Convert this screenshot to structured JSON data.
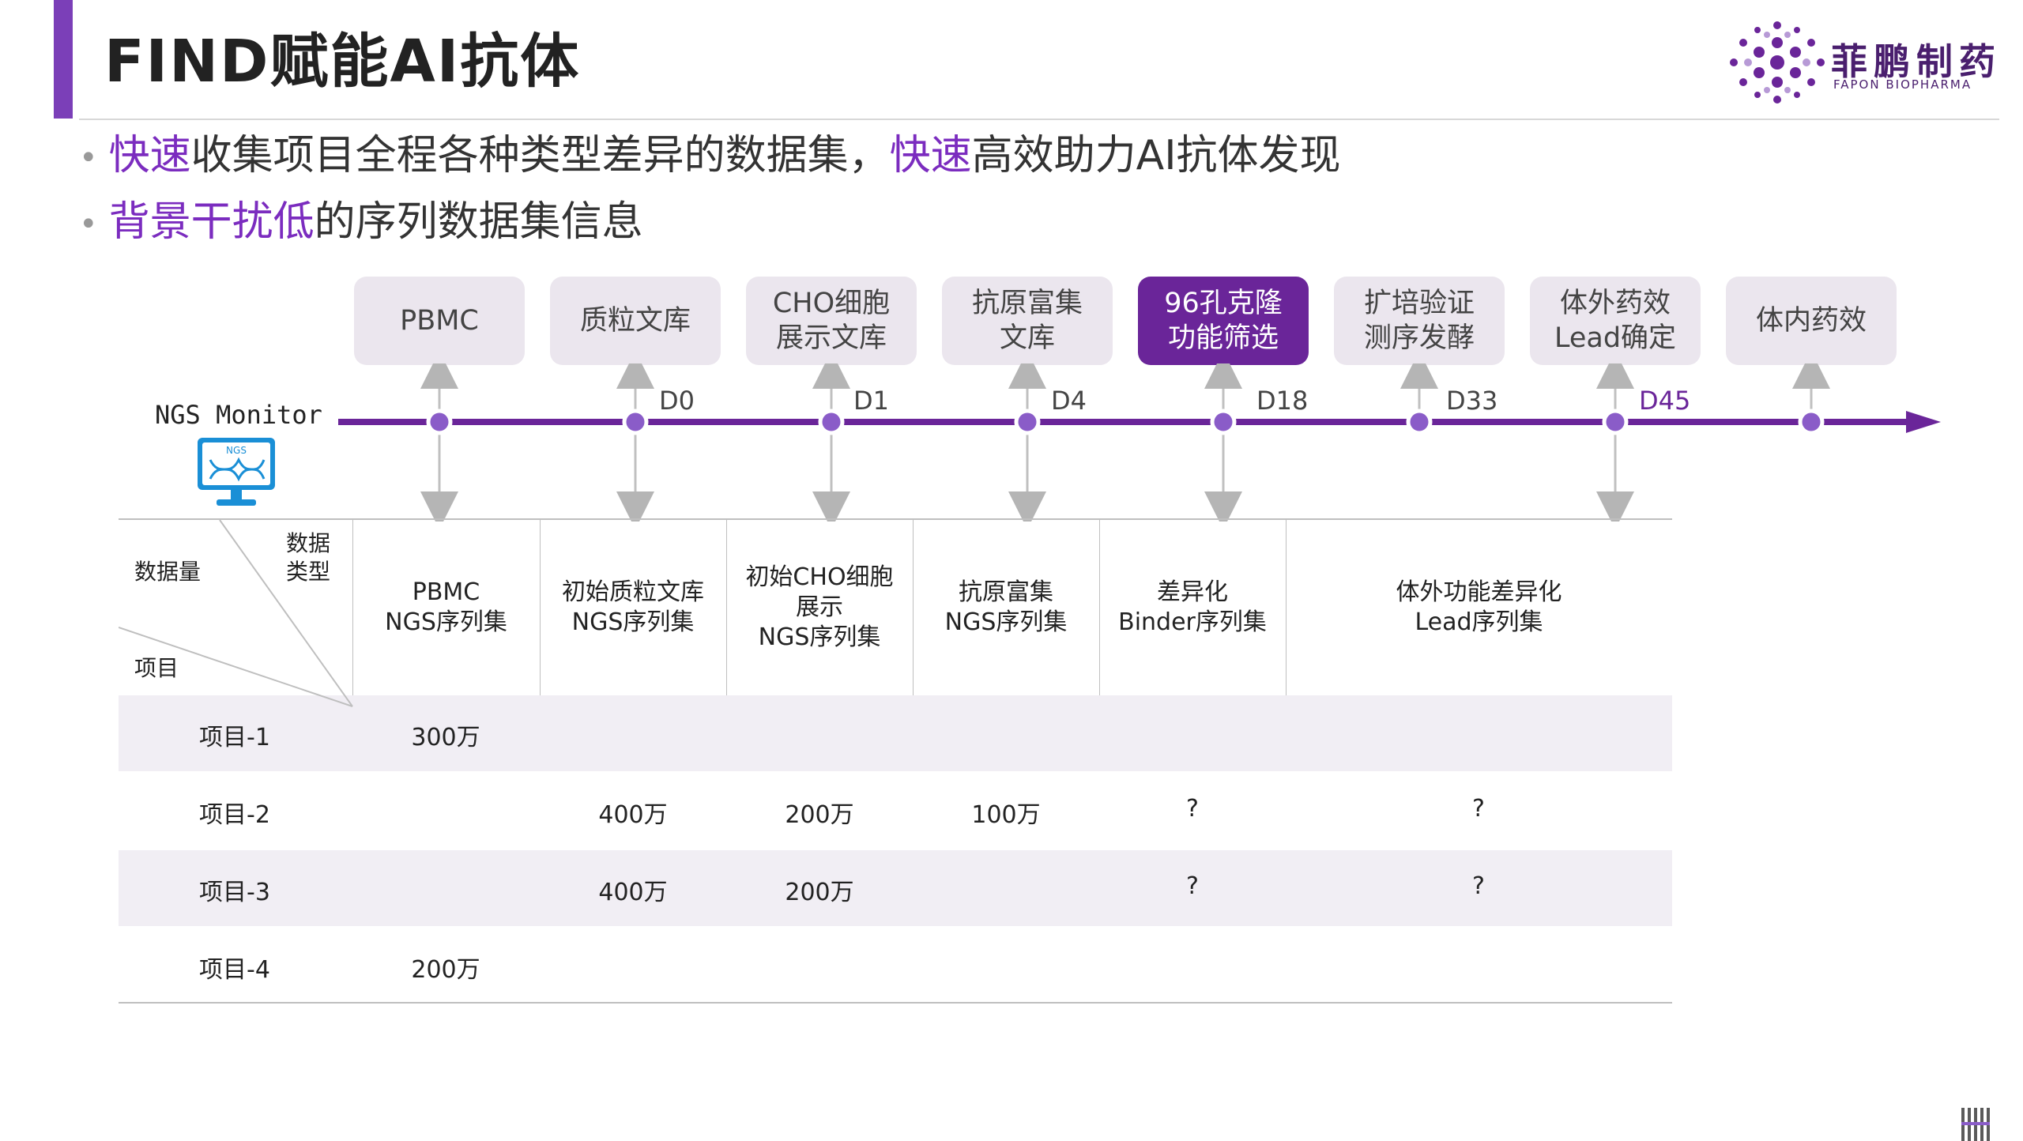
{
  "title": "FIND赋能AI抗体",
  "logo": {
    "cn": "菲鹏制药",
    "en": "FAPON BIOPHARMA"
  },
  "bullets": [
    [
      {
        "text": "快速",
        "hl": true
      },
      {
        "text": "收集项目全程各种类型差异的数据集，",
        "hl": false
      },
      {
        "text": "快速",
        "hl": true
      },
      {
        "text": "高效助力AI抗体发现",
        "hl": false
      }
    ],
    [
      {
        "text": "背景干扰低",
        "hl": true
      },
      {
        "text": "的序列数据集信息",
        "hl": false
      }
    ]
  ],
  "stages": [
    {
      "label": "PBMC",
      "active": false
    },
    {
      "label": "质粒文库",
      "active": false
    },
    {
      "label": "CHO细胞\n展示文库",
      "active": false
    },
    {
      "label": "抗原富集\n文库",
      "active": false
    },
    {
      "label": "96孔克隆\n功能筛选",
      "active": true
    },
    {
      "label": "扩培验证\n测序发酵",
      "active": false
    },
    {
      "label": "体外药效\nLead确定",
      "active": false
    },
    {
      "label": "体内药效",
      "active": false
    }
  ],
  "timeline": {
    "monitor_label": "NGS Monitor",
    "monitor_icon": "ngs-monitor-icon",
    "monitor_icon_text": "NGS",
    "days": [
      "D0",
      "D1",
      "D4",
      "D18",
      "D33",
      "D45"
    ],
    "highlight_day": "D45",
    "accent_color": "#6a2599",
    "node_color": "#8a5cc8"
  },
  "table": {
    "corner": {
      "type_label": "数据\n类型",
      "amount_label": "数据量",
      "project_label": "项目"
    },
    "columns": [
      "PBMC\nNGS序列集",
      "初始质粒文库\nNGS序列集",
      "初始CHO细胞\n展示\nNGS序列集",
      "抗原富集\nNGS序列集",
      "差异化\nBinder序列集",
      "体外功能差异化\nLead序列集"
    ],
    "rows": [
      {
        "name": "项目-1",
        "cells": [
          "300万",
          "",
          "",
          "",
          "",
          ""
        ]
      },
      {
        "name": "项目-2",
        "cells": [
          "",
          "400万",
          "200万",
          "100万",
          "?",
          "?"
        ]
      },
      {
        "name": "项目-3",
        "cells": [
          "",
          "400万",
          "200万",
          "",
          "?",
          "?"
        ]
      },
      {
        "name": "项目-4",
        "cells": [
          "200万",
          "",
          "",
          "",
          "",
          ""
        ]
      }
    ]
  }
}
